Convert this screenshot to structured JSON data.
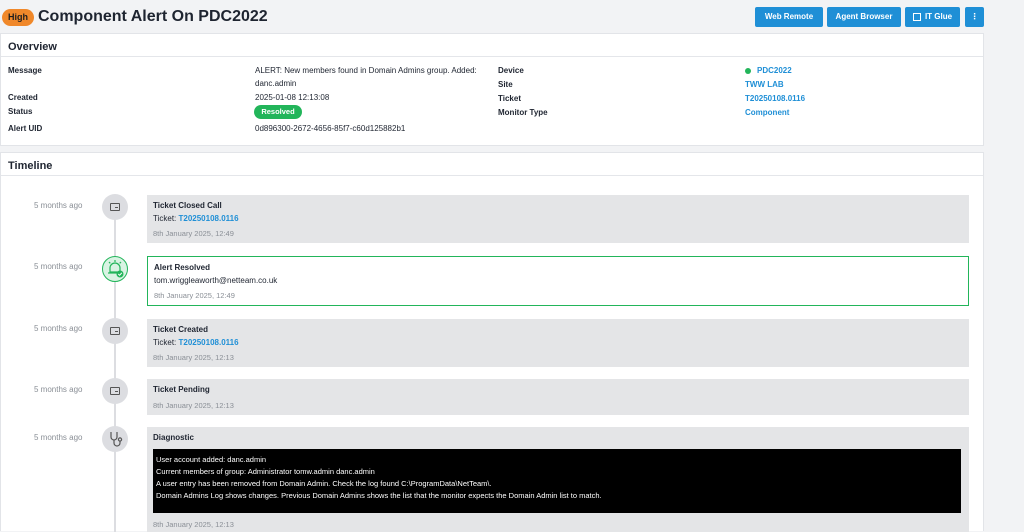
{
  "header": {
    "severity": "High",
    "title": "Component Alert On PDC2022",
    "buttons": {
      "web_remote": "Web Remote",
      "agent_browser": "Agent Browser",
      "it_glue": "IT Glue",
      "more": "⋮"
    }
  },
  "overview": {
    "title": "Overview",
    "labels": {
      "message": "Message",
      "created": "Created",
      "status": "Status",
      "alert_uid": "Alert UID",
      "device": "Device",
      "site": "Site",
      "ticket": "Ticket",
      "monitor_type": "Monitor Type"
    },
    "values": {
      "message_line1": "ALERT: New members found in Domain Admins group. Added:",
      "message_line2": "danc.admin",
      "created": "2025-01-08 12:13:08",
      "status": "Resolved",
      "alert_uid": "0d896300-2672-4656-85f7-c60d125882b1",
      "device": "PDC2022",
      "site": "TWW LAB",
      "ticket": "T20250108.0116",
      "monitor_type": "Component"
    },
    "status_color": "#22b55a"
  },
  "timeline": {
    "title": "Timeline",
    "events": [
      {
        "time": "5 months ago",
        "title": "Ticket Closed Call",
        "prefix": "Ticket: ",
        "link": "T20250108.0116",
        "date": "8th January 2025, 12:49",
        "icon": "ticket-icon"
      },
      {
        "time": "5 months ago",
        "title": "Alert Resolved",
        "detail": "tom.wriggleaworth@netteam.co.uk",
        "date": "8th January 2025, 12:49",
        "icon": "alarm-check-icon"
      },
      {
        "time": "5 months ago",
        "title": "Ticket Created",
        "prefix": "Ticket: ",
        "link": "T20250108.0116",
        "date": "8th January 2025, 12:13",
        "icon": "ticket-icon"
      },
      {
        "time": "5 months ago",
        "title": "Ticket Pending",
        "date": "8th January 2025, 12:13",
        "icon": "ticket-icon"
      },
      {
        "time": "5 months ago",
        "title": "Diagnostic",
        "date": "8th January 2025, 12:13",
        "icon": "stethoscope-icon",
        "lines": [
          "User account added: danc.admin",
          "Current members of group: Administrator tomw.admin danc.admin",
          "A user entry has been removed from Domain Admin. Check the log found C:\\ProgramData\\NetTeam\\.",
          "Domain Admins Log shows changes. Previous Domain Admins shows the list that the monitor expects the Domain Admin list to match."
        ]
      }
    ]
  },
  "colors": {
    "accent": "#1f8fd6",
    "high": "#f0882a",
    "success": "#22b55a"
  }
}
